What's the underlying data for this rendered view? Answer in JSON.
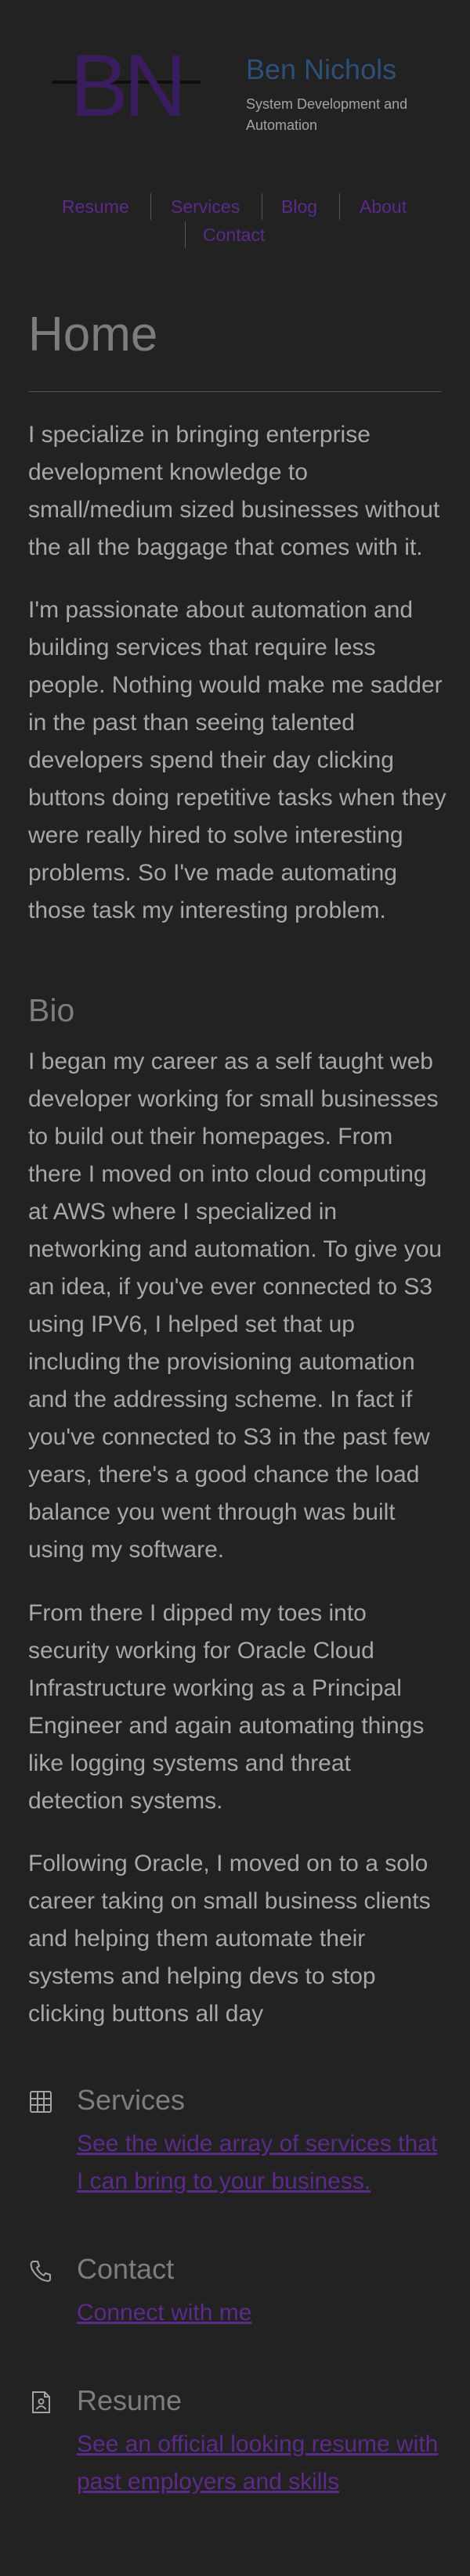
{
  "header": {
    "logo_letters": "BN",
    "site_title": "Ben Nichols",
    "tagline": "System Development and Automation"
  },
  "nav": {
    "items": [
      "Resume",
      "Services",
      "Blog",
      "About",
      "Contact"
    ]
  },
  "main": {
    "title": "Home",
    "intro_paragraphs": [
      "I specialize in bringing enterprise development knowledge to small/medium sized businesses without the all the baggage that comes with it.",
      "I'm passionate about automation and building services that require less people. Nothing would make me sadder in the past than seeing talented developers spend their day clicking buttons doing repetitive tasks when they were really hired to solve interesting problems. So I've made automating those task my interesting problem."
    ],
    "bio_heading": "Bio",
    "bio_paragraphs": [
      "I began my career as a self taught web developer working for small businesses to build out their homepages. From there I moved on into cloud computing at AWS where I specialized in networking and automation. To give you an idea, if you've ever connected to S3 using IPV6, I helped set that up including the provisioning automation and the addressing scheme. In fact if you've connected to S3 in the past few years, there's a good chance the load balance you went through was built using my software.",
      "From there I dipped my toes into security working for Oracle Cloud Infrastructure working as a Principal Engineer and again automating things like logging systems and threat detection systems.",
      "Following Oracle, I moved on to a solo career taking on small business clients and helping them automate their systems and helping devs to stop clicking buttons all day"
    ]
  },
  "features": [
    {
      "icon": "grid-icon",
      "title": "Services",
      "description": "See the wide array of services that I can bring to your business."
    },
    {
      "icon": "phone-icon",
      "title": "Contact",
      "description": "Connect with me"
    },
    {
      "icon": "document-icon",
      "title": "Resume",
      "description": "See an official looking resume with past employers and skills"
    }
  ],
  "colors": {
    "background": "#222222",
    "title_blue": "#2e4f78",
    "link_purple": "#5b2a8a",
    "text": "#a8a8a8",
    "heading_gray": "#7d7d7d"
  }
}
